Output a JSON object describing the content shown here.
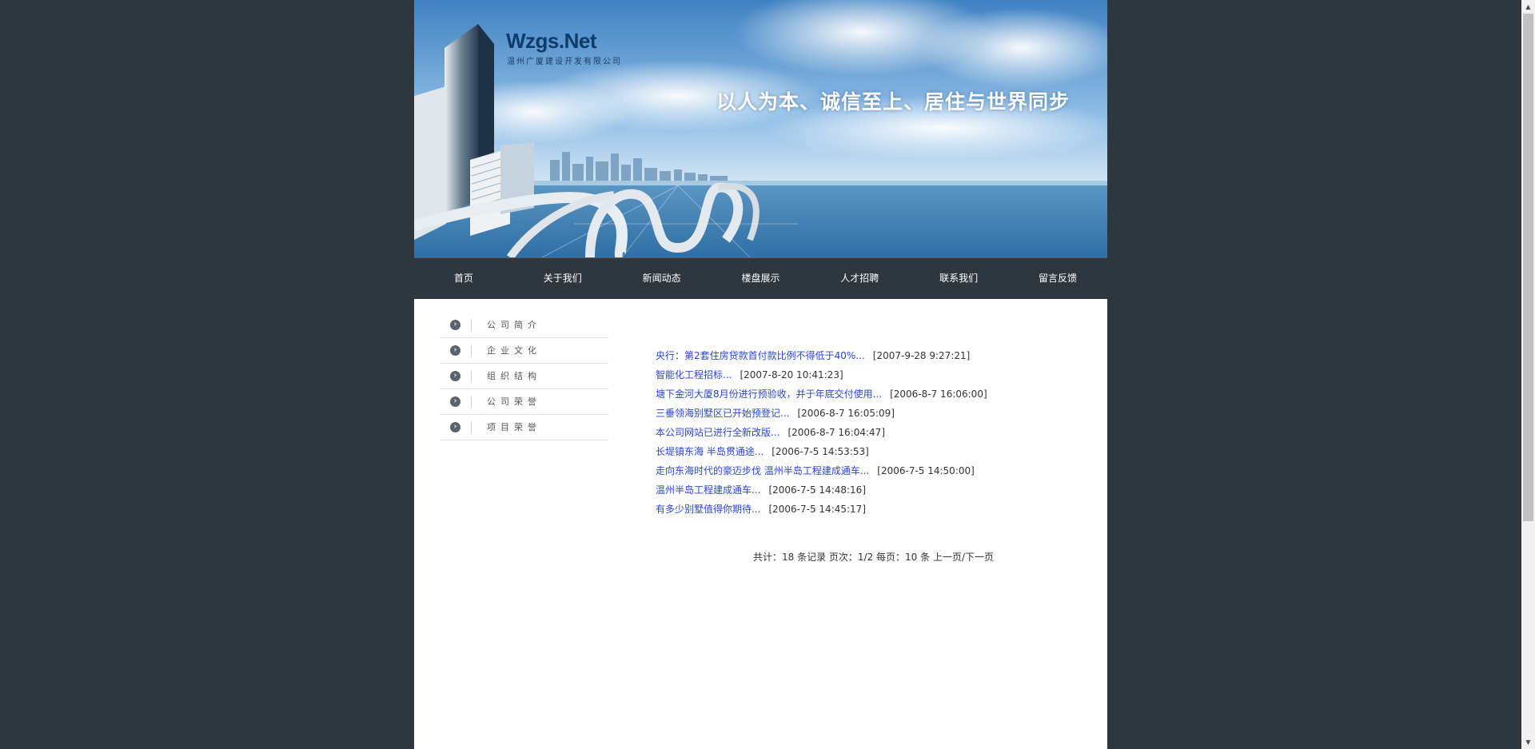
{
  "banner": {
    "logo": "Wzgs.Net",
    "company": "温州广厦建设开发有限公司",
    "slogan": "以人为本、诚信至上、居住与世界同步"
  },
  "nav": {
    "items": [
      {
        "label": "首页"
      },
      {
        "label": "关于我们"
      },
      {
        "label": "新闻动态"
      },
      {
        "label": "楼盘展示"
      },
      {
        "label": "人才招聘"
      },
      {
        "label": "联系我们"
      },
      {
        "label": "留言反馈"
      }
    ]
  },
  "sidebar": {
    "icon": "chevron-right-circle-icon",
    "items": [
      {
        "label": "公司简介"
      },
      {
        "label": "企业文化"
      },
      {
        "label": "组织结构"
      },
      {
        "label": "公司荣誉"
      },
      {
        "label": "项目荣誉"
      }
    ]
  },
  "news": {
    "items": [
      {
        "title": "央行：第2套住房贷款首付款比例不得低于40%...",
        "date": "[2007-9-28 9:27:21]"
      },
      {
        "title": "智能化工程招标...",
        "date": "[2007-8-20 10:41:23]"
      },
      {
        "title": "塘下金河大厦8月份进行预验收，并于年底交付使用...",
        "date": "[2006-8-7 16:06:00]"
      },
      {
        "title": "三垂领海别墅区已开始预登记...",
        "date": "[2006-8-7 16:05:09]"
      },
      {
        "title": "本公司网站已进行全新改版...",
        "date": "[2006-8-7 16:04:47]"
      },
      {
        "title": "长堤镇东海 半岛贯通途...",
        "date": "[2006-7-5 14:53:53]"
      },
      {
        "title": "走向东海时代的豪迈步伐 温州半岛工程建成通车...",
        "date": "[2006-7-5 14:50:00]"
      },
      {
        "title": "温州半岛工程建成通车...",
        "date": "[2006-7-5 14:48:16]"
      },
      {
        "title": "有多少别墅值得你期待...",
        "date": "[2006-7-5 14:45:17]"
      }
    ]
  },
  "pager": {
    "summary": "共计：18 条记录 页次：1/2 每页：10 条",
    "prev": "上一页",
    "sep": "/",
    "next": "下一页"
  },
  "colors": {
    "background": "#2e373e",
    "link": "#2a45d6",
    "nav": "#2e373e"
  }
}
